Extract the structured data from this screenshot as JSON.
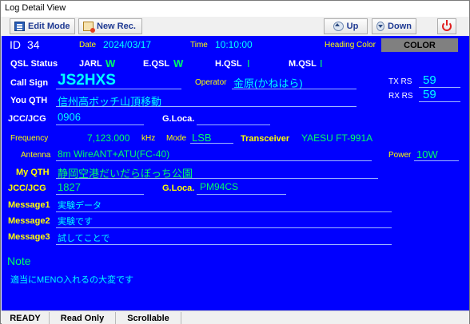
{
  "window": {
    "title": "Log Detail View"
  },
  "toolbar": {
    "edit_mode": "Edit Mode",
    "new_rec": "New Rec.",
    "up": "Up",
    "down": "Down"
  },
  "record": {
    "id_label": "ID",
    "id": "34",
    "date_label": "Date",
    "date": "2024/03/17",
    "time_label": "Time",
    "time": "10:10:00",
    "heading_color_label": "Heading Color",
    "heading_color_value": "COLOR",
    "qsl_status_label": "QSL Status",
    "jarl_label": "JARL",
    "jarl": "W",
    "eqsl_label": "E.QSL",
    "eqsl": "W",
    "hqsl_label": "H.QSL",
    "hqsl": "I",
    "mqsl_label": "M.QSL",
    "mqsl": "I",
    "callsign_label": "Call Sign",
    "callsign": "JS2HXS",
    "operator_label": "Operator",
    "operator": "金原(かねはら)",
    "txrs_label": "TX RS",
    "txrs": "59",
    "rxrs_label": "RX RS",
    "rxrs": "59",
    "your_qth_label": "You QTH",
    "your_qth": "信州高ボッチ山頂移動",
    "jcc1_label": "JCC/JCG",
    "jcc1": "0906",
    "gloca1_label": "G.Loca.",
    "gloca1": "",
    "freq_label": "Frequency",
    "freq": "7,123.000",
    "freq_unit": "kHz",
    "mode_label": "Mode",
    "mode": "LSB",
    "transceiver_label": "Transceiver",
    "transceiver": "YAESU FT-991A",
    "antenna_label": "Antenna",
    "antenna": "8m WireANT+ATU(FC-40)",
    "power_label": "Power",
    "power": "10W",
    "my_qth_label": "My QTH",
    "my_qth": "静岡空港だいだらぼっち公園",
    "jcc2_label": "JCC/JCG",
    "jcc2": "1827",
    "gloca2_label": "G.Loca.",
    "gloca2": "PM94CS",
    "msg1_label": "Message1",
    "msg1": "実験データ",
    "msg2_label": "Message2",
    "msg2": "実験です",
    "msg3_label": "Message3",
    "msg3": "試してことで",
    "note_label": "Note",
    "note": "適当にMENO入れるの大変です"
  },
  "status": {
    "s1": "READY",
    "s2": "Read Only",
    "s3": "Scrollable"
  },
  "colors": {
    "panel": "#0000ff",
    "label_yellow": "#ffff00",
    "value_green": "#00ff66",
    "value_cyan": "#00ffff"
  }
}
